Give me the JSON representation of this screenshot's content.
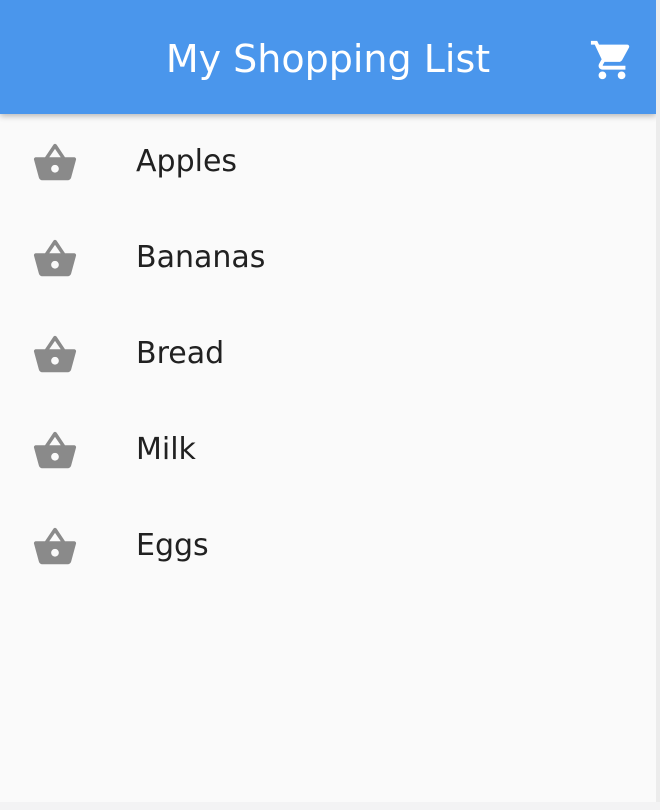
{
  "appbar": {
    "title": "My Shopping List",
    "cart_icon": "shopping-cart-icon",
    "background_color": "#4a96ec"
  },
  "items": [
    {
      "label": "Apples",
      "icon": "shopping-basket-icon"
    },
    {
      "label": "Bananas",
      "icon": "shopping-basket-icon"
    },
    {
      "label": "Bread",
      "icon": "shopping-basket-icon"
    },
    {
      "label": "Milk",
      "icon": "shopping-basket-icon"
    },
    {
      "label": "Eggs",
      "icon": "shopping-basket-icon"
    }
  ],
  "colors": {
    "icon": "#8a8a8a",
    "text": "#212121",
    "background": "#fafafa"
  }
}
